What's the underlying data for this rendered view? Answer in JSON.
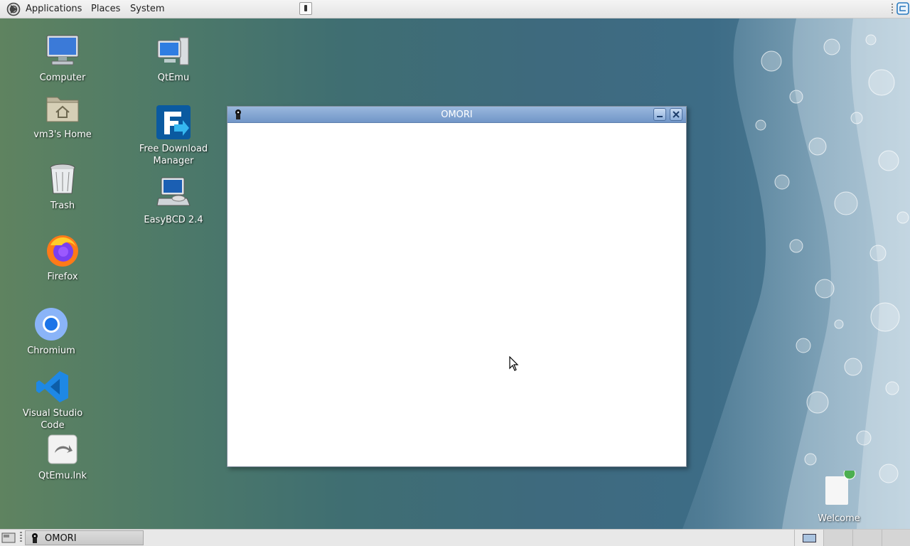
{
  "top_panel": {
    "menus": [
      "Applications",
      "Places",
      "System"
    ]
  },
  "desktop_icons": {
    "col1": [
      "Computer",
      "vm3's Home",
      "Trash",
      "Firefox",
      "Chromium",
      "Visual Studio Code",
      "QtEmu.lnk"
    ],
    "col2": [
      "QtEmu",
      "Free Download Manager",
      "EasyBCD 2.4"
    ],
    "welcome": "Welcome"
  },
  "window": {
    "title": "OMORI"
  },
  "taskbar": {
    "tasks": [
      "OMORI"
    ],
    "workspaces": 4
  },
  "colors": {
    "titlebar": "#7196c8",
    "desktop_left": "#5f8360",
    "desktop_right": "#3d6c86"
  }
}
